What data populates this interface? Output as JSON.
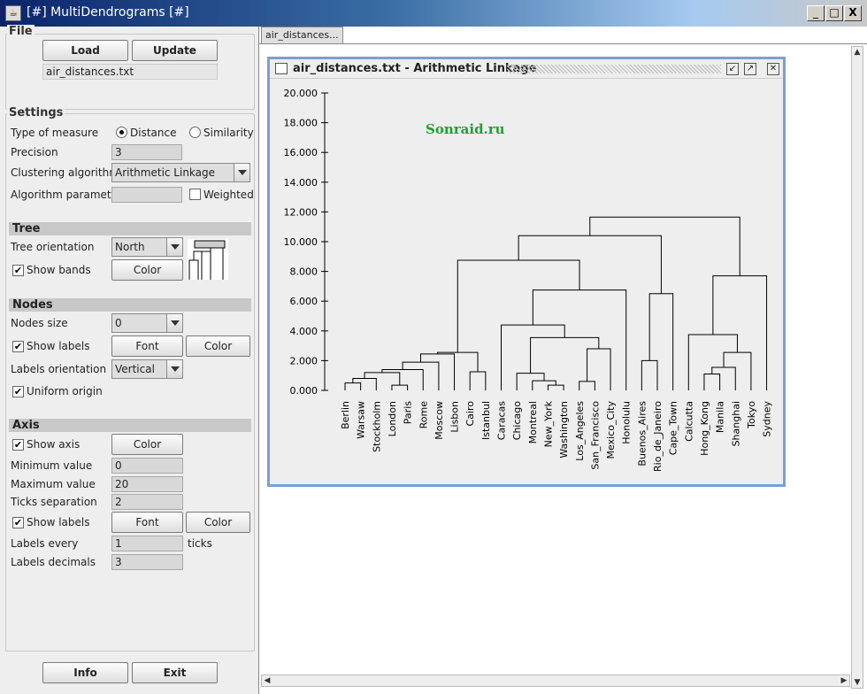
{
  "window": {
    "title": "[#] MultiDendrograms [#]",
    "min_label": "_",
    "max_label": "□",
    "close_label": "X"
  },
  "file": {
    "title": "File",
    "load_label": "Load",
    "update_label": "Update",
    "filename": "air_distances.txt"
  },
  "settings": {
    "title": "Settings",
    "measure_label": "Type of measure",
    "distance_label": "Distance",
    "similarity_label": "Similarity",
    "precision_label": "Precision",
    "precision_value": "3",
    "algorithm_label": "Clustering algorithm",
    "algorithm_value": "Arithmetic Linkage",
    "param_label": "Algorithm parameter",
    "weighted_label": "Weighted"
  },
  "tree": {
    "title": "Tree",
    "orientation_label": "Tree orientation",
    "orientation_value": "North",
    "bands_label": "Show bands",
    "color_label": "Color"
  },
  "nodes": {
    "title": "Nodes",
    "size_label": "Nodes size",
    "size_value": "0",
    "labels_label": "Show labels",
    "font_label": "Font",
    "color_label": "Color",
    "orient_label": "Labels orientation",
    "orient_value": "Vertical",
    "uniform_label": "Uniform origin"
  },
  "axis": {
    "title": "Axis",
    "show_label": "Show axis",
    "color_label": "Color",
    "min_label": "Minimum value",
    "min_value": "0",
    "max_label": "Maximum value",
    "max_value": "20",
    "ticks_label": "Ticks separation",
    "ticks_value": "2",
    "labels_label": "Show labels",
    "font_label": "Font",
    "color2_label": "Color",
    "every_label": "Labels every",
    "every_value": "1",
    "ticks_word": "ticks",
    "decimals_label": "Labels decimals",
    "decimals_value": "3"
  },
  "bottom": {
    "info_label": "Info",
    "exit_label": "Exit"
  },
  "right_tab": "air_distances...",
  "inner_window": {
    "title": "air_distances.txt - Arithmetic Linkage"
  },
  "watermark": "Sonraid.ru",
  "chart_data": {
    "type": "dendrogram",
    "ylim": [
      0,
      20
    ],
    "yticks": [
      "0.000",
      "2.000",
      "4.000",
      "6.000",
      "8.000",
      "10.000",
      "12.000",
      "14.000",
      "16.000",
      "18.000",
      "20.000"
    ],
    "leaves": [
      "Berlin",
      "Warsaw",
      "Stockholm",
      "London",
      "Paris",
      "Rome",
      "Moscow",
      "Lisbon",
      "Cairo",
      "Istanbul",
      "Caracas",
      "Chicago",
      "Montreal",
      "New_York",
      "Washington",
      "Los_Angeles",
      "San_Francisco",
      "Mexico_City",
      "Honolulu",
      "Buenos_Aires",
      "Rio_de_Janeiro",
      "Cape_Town",
      "Calcutta",
      "Hong_Kong",
      "Manila",
      "Shanghai",
      "Tokyo",
      "Sydney"
    ],
    "merges": [
      {
        "a": "L0",
        "b": "L1",
        "h": 0.5
      },
      {
        "a": "M0",
        "b": "L2",
        "h": 0.8
      },
      {
        "a": "L3",
        "b": "L4",
        "h": 0.35
      },
      {
        "a": "M1",
        "b": "M2",
        "h": 1.2
      },
      {
        "a": "M3",
        "b": "L5",
        "h": 1.4
      },
      {
        "a": "M4",
        "b": "L6",
        "h": 1.9
      },
      {
        "a": "M5",
        "b": "L7",
        "h": 2.45
      },
      {
        "a": "L8",
        "b": "L9",
        "h": 1.25
      },
      {
        "a": "M6",
        "b": "M7",
        "h": 2.55
      },
      {
        "a": "L13",
        "b": "L14",
        "h": 0.35
      },
      {
        "a": "L12",
        "b": "M9",
        "h": 0.65
      },
      {
        "a": "L11",
        "b": "M10",
        "h": 1.15
      },
      {
        "a": "L15",
        "b": "L16",
        "h": 0.6
      },
      {
        "a": "M12",
        "b": "L17",
        "h": 2.8
      },
      {
        "a": "M11",
        "b": "M13",
        "h": 3.55
      },
      {
        "a": "L10",
        "b": "M14",
        "h": 4.4
      },
      {
        "a": "M15",
        "b": "L18",
        "h": 6.75
      },
      {
        "a": "M8",
        "b": "M16",
        "h": 8.75
      },
      {
        "a": "L19",
        "b": "L20",
        "h": 2.0
      },
      {
        "a": "M18",
        "b": "L21",
        "h": 6.5
      },
      {
        "a": "M17",
        "b": "M19",
        "h": 10.4
      },
      {
        "a": "L23",
        "b": "L24",
        "h": 1.1
      },
      {
        "a": "M21",
        "b": "L25",
        "h": 1.55
      },
      {
        "a": "M22",
        "b": "L26",
        "h": 2.55
      },
      {
        "a": "L22",
        "b": "M23",
        "h": 3.75
      },
      {
        "a": "M24",
        "b": "L27",
        "h": 7.7
      },
      {
        "a": "M20",
        "b": "M25",
        "h": 11.65
      }
    ]
  }
}
